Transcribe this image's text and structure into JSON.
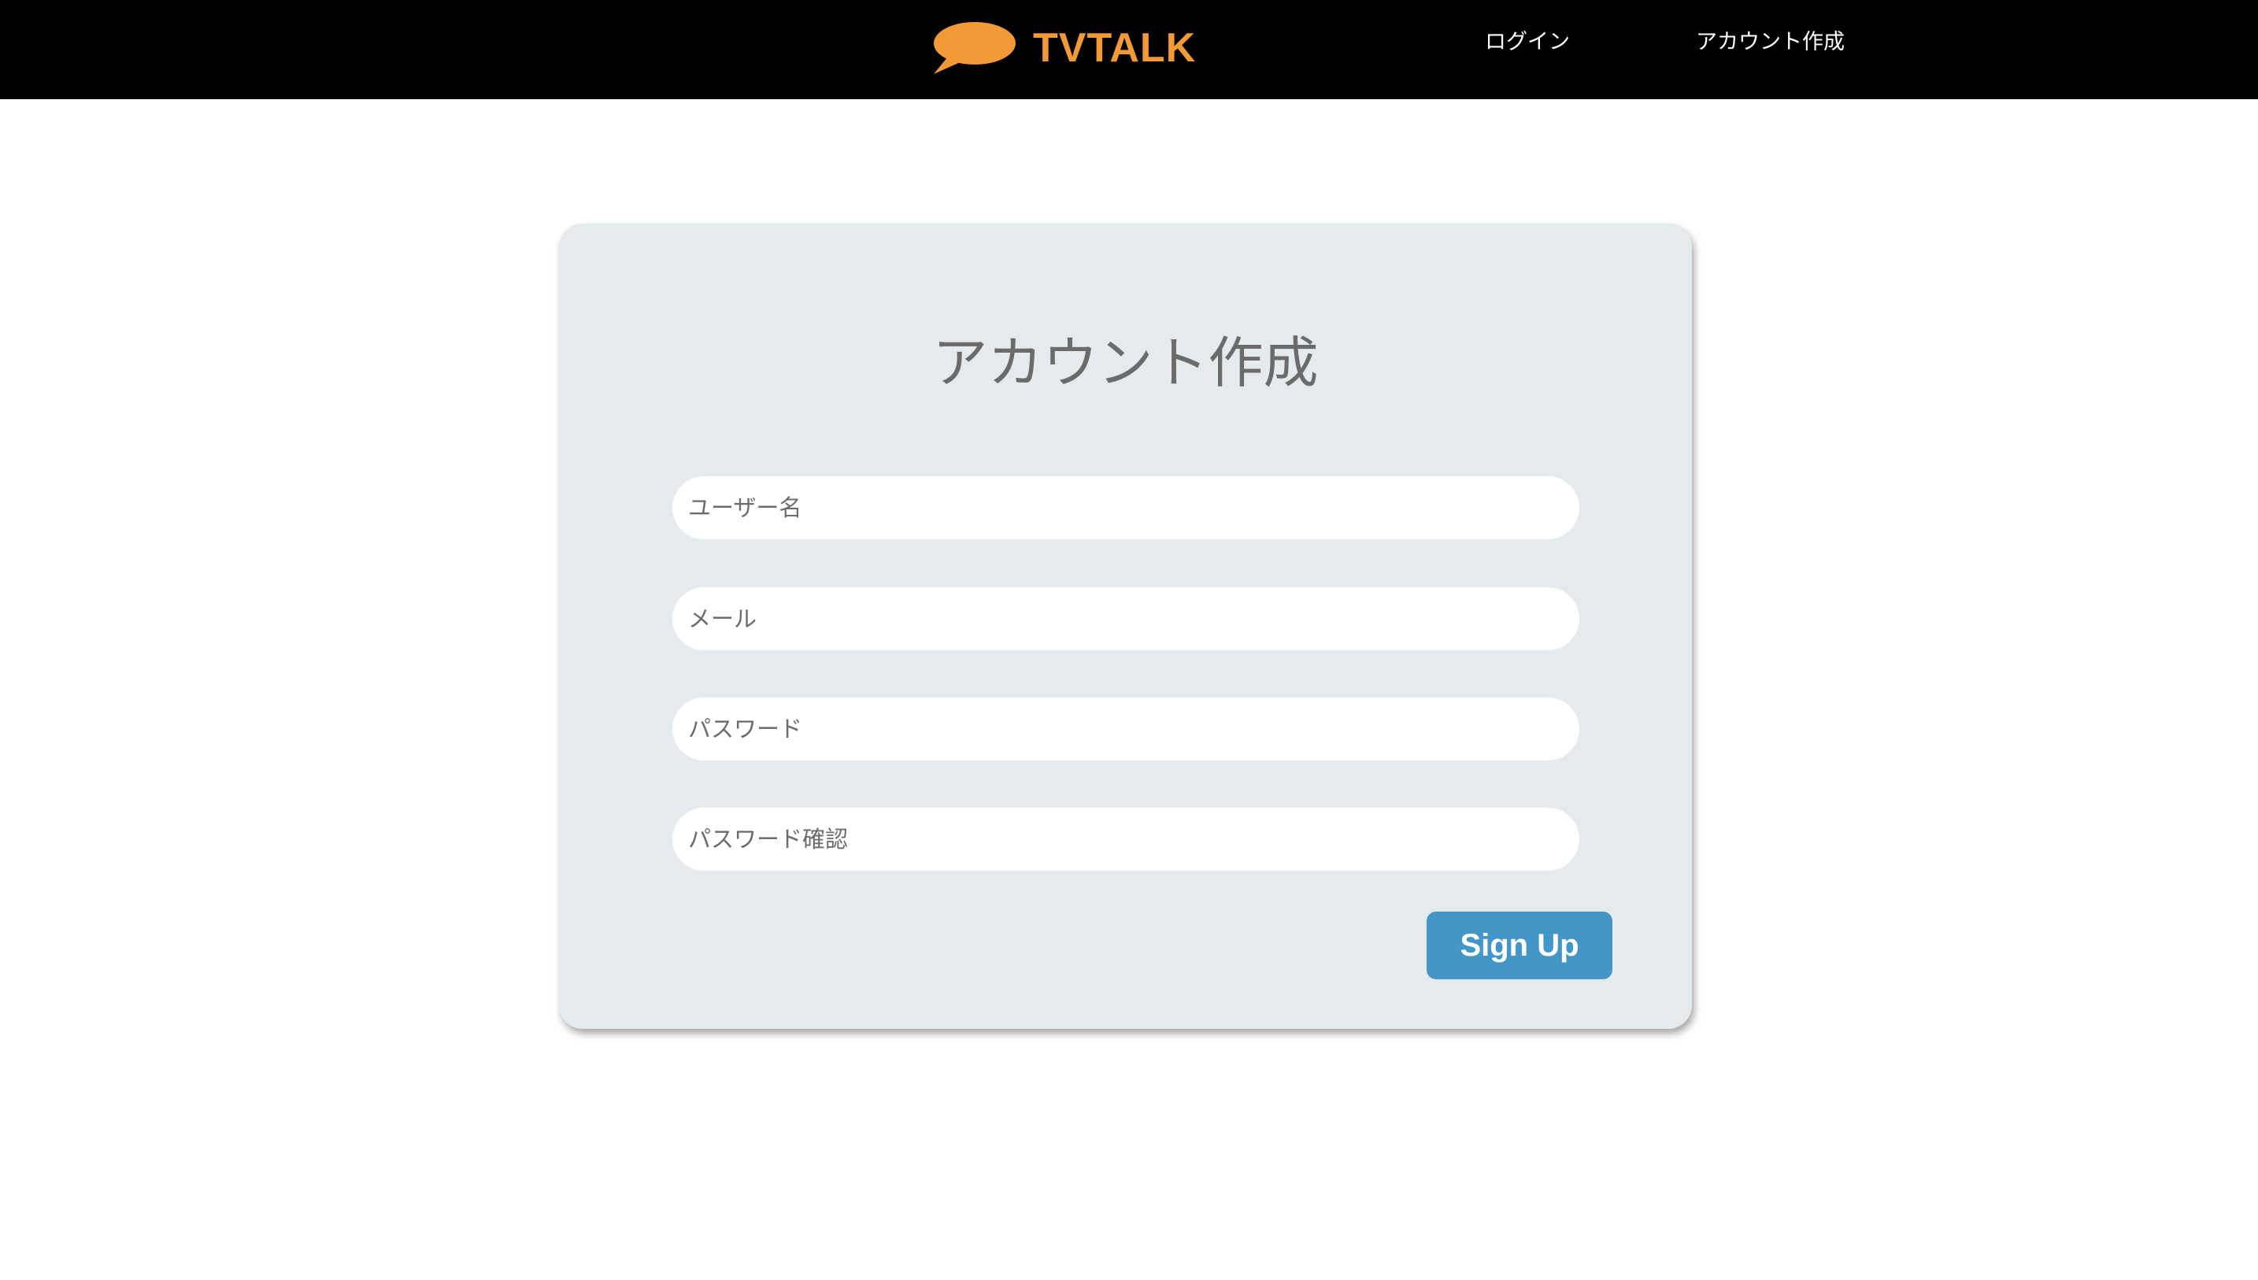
{
  "header": {
    "logo_text": "TVTALK",
    "logo_icon": "speech-bubble-icon",
    "nav": {
      "login": "ログイン",
      "signup": "アカウント作成"
    }
  },
  "form": {
    "title": "アカウント作成",
    "fields": {
      "username": {
        "placeholder": "ユーザー名",
        "value": ""
      },
      "email": {
        "placeholder": "メール",
        "value": ""
      },
      "password": {
        "placeholder": "パスワード",
        "value": ""
      },
      "password_confirm": {
        "placeholder": "パスワード確認",
        "value": ""
      }
    },
    "submit_label": "Sign Up"
  },
  "colors": {
    "header_bg": "#000000",
    "brand_orange": "#f39a38",
    "card_bg": "#e5ebed",
    "button_bg": "#4396c8",
    "title_text": "#6b6b6b"
  }
}
